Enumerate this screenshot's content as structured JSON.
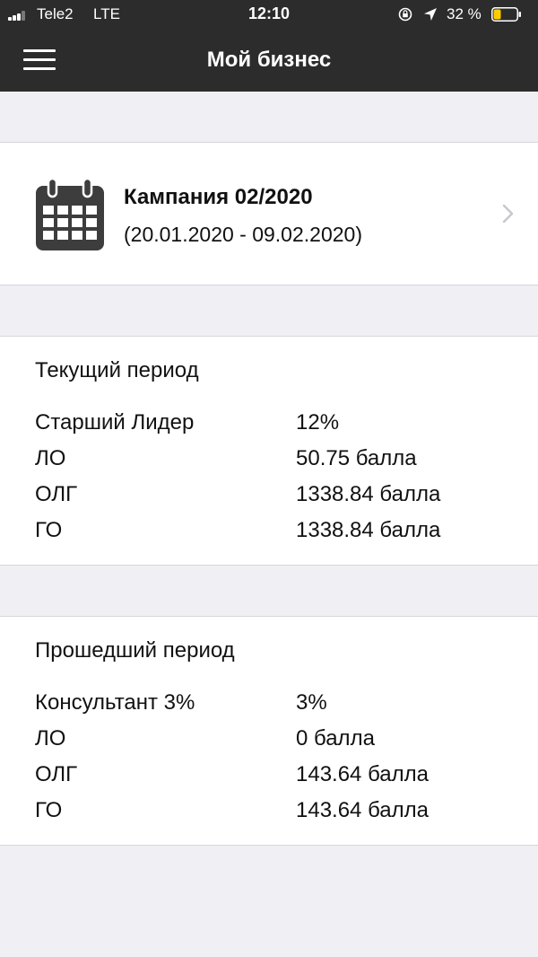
{
  "status_bar": {
    "carrier": "Tele2",
    "network": "LTE",
    "time": "12:10",
    "battery_percent": "32 %",
    "battery_level": 0.32,
    "icons": [
      "signal-icon",
      "orientation-lock-icon",
      "location-icon",
      "battery-icon"
    ]
  },
  "nav": {
    "title": "Мой бизнес",
    "menu_icon": "hamburger-menu-icon"
  },
  "campaign": {
    "title": "Кампания 02/2020",
    "dates": "(20.01.2020 - 09.02.2020)",
    "icon": "calendar-icon",
    "chevron": "chevron-right-icon"
  },
  "current_period": {
    "title": "Текущий период",
    "rows": [
      {
        "label": "Старший Лидер",
        "value": "12%"
      },
      {
        "label": "ЛО",
        "value": "50.75 балла"
      },
      {
        "label": "ОЛГ",
        "value": "1338.84 балла"
      },
      {
        "label": "ГО",
        "value": "1338.84 балла"
      }
    ]
  },
  "previous_period": {
    "title": "Прошедший период",
    "rows": [
      {
        "label": "Консультант 3%",
        "value": "3%"
      },
      {
        "label": "ЛО",
        "value": "0 балла"
      },
      {
        "label": "ОЛГ",
        "value": "143.64 балла"
      },
      {
        "label": "ГО",
        "value": "143.64 балла"
      }
    ]
  },
  "colors": {
    "nav_background": "#2c2c2c",
    "page_background": "#efeff4",
    "card_background": "#ffffff",
    "battery_fill": "#ffcc00",
    "icon_gray": "#3d3d3d",
    "chevron_gray": "#c7c7cc"
  }
}
